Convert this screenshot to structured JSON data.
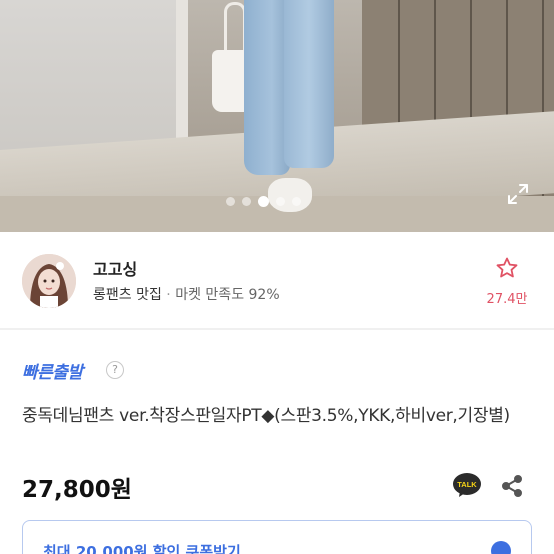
{
  "gallery": {
    "total_images": 5,
    "active_index": 3,
    "expand_icon": "expand-icon"
  },
  "seller": {
    "name": "고고싱",
    "category": "롱팬츠 맛집",
    "separator": " · ",
    "satisfaction": "마켓 만족도 92%",
    "like_icon": "star-outline-icon",
    "like_count": "27.4만"
  },
  "product": {
    "shipping_badge": "빠른출발",
    "help_label": "?",
    "title": "중독데님팬츠 ver.착장스판일자PT◆(스판3.5%,YKK,하비ver,기장별)",
    "price": "27,800원",
    "talk_label": "TALK",
    "share_icon": "share-icon"
  },
  "coupon": {
    "label": "최대 20,000원 할인 쿠폰받기"
  },
  "colors": {
    "accent_blue": "#3d6fe0",
    "like_pink": "#e05264",
    "talk_badge": "#2b2b2b"
  }
}
